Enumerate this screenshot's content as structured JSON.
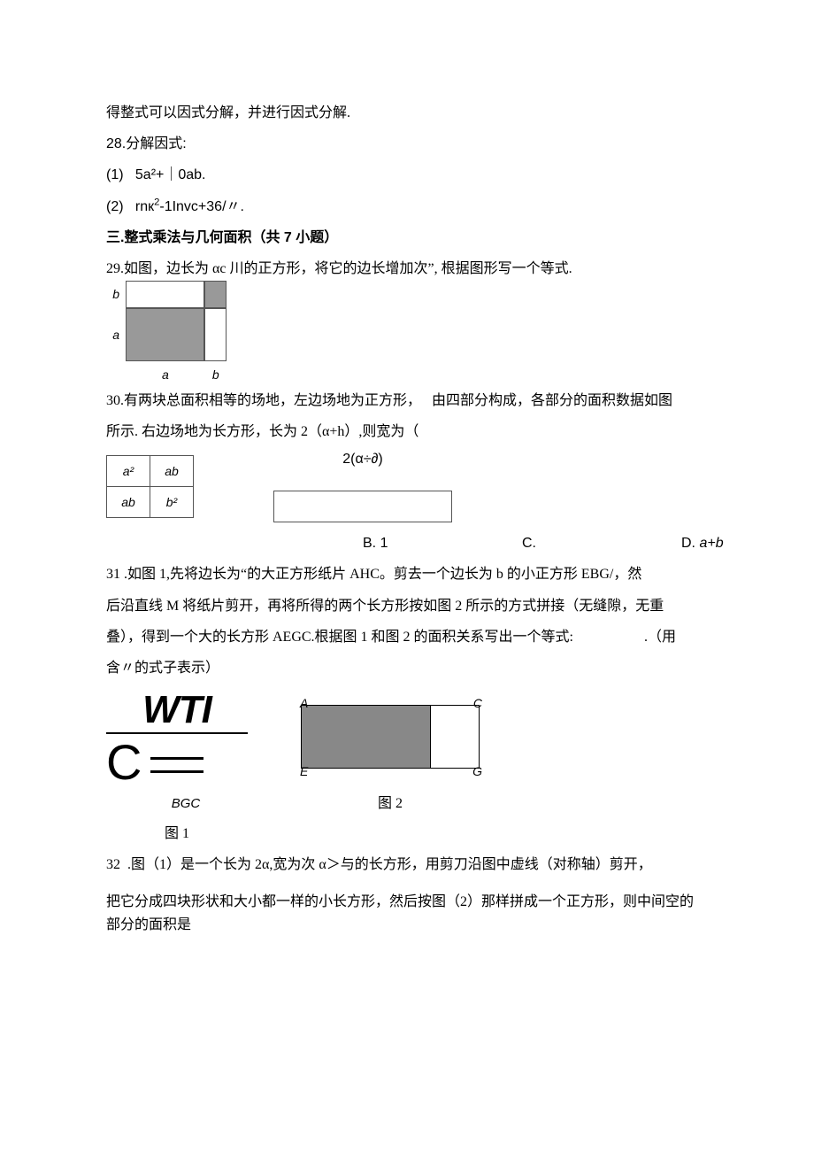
{
  "line_factor": "得整式可以因式分解，并进行因式分解.",
  "q28": {
    "title": "28.分解因式:",
    "p1": "(1)   5a²+｜0ab.",
    "p2_a": "(2)   rnк",
    "p2_b": "-1Invc+36/〃."
  },
  "sec3": "三.整式乘法与几何面积（共 7 小题）",
  "q29": {
    "text": "29.如图，边长为 αc 川的正方形，将它的边长增加次”, 根据图形写一个等式.",
    "lbl_b1": "b",
    "lbl_a1": "a",
    "lbl_a2": "a",
    "lbl_b2": "b"
  },
  "q30": {
    "l1": "30.有两块总面积相等的场地，左边场地为正方形，   由四部分构成，各部分的面积数据如图",
    "l2": "所示. 右边场地为长方形，长为 2（α+h）,则宽为（",
    "a2": "a²",
    "ab": "ab",
    "b2": "b²",
    "top": "2(α÷∂)",
    "cB": "B. 1",
    "cC": "C.",
    "cD_pre": "D. ",
    "cD_val": "a+b"
  },
  "q31": {
    "l1": "31 .如图 1,先将边长为“的大正方形纸片 AHC。剪去一个边长为 b 的小正方形 EBG/，然",
    "l2": "后沿直线 M 将纸片剪开，再将所得的两个长方形按如图 2 所示的方式拼接（无缝隙，无重",
    "l3_a": "叠），得到一个大的长方形 AEGC.根据图 1 和图 2 的面积关系写出一个等式:",
    "l3_b": ".（用",
    "l4": "含〃的式子表示）",
    "wti": "WTI",
    "c": "C",
    "bgc": "BGC",
    "fig1": "图 1",
    "fig2": "图 2",
    "A": "A",
    "Cc": "C",
    "E": "E",
    "G": "G"
  },
  "q32": {
    "l1": "32  .图（1）是一个长为 2α,宽为次 α＞与的长方形，用剪刀沿图中虚线（对称轴）剪开，",
    "l2": "把它分成四块形状和大小都一样的小长方形，然后按图（2）那样拼成一个正方形，则中间空的",
    "l3": "部分的面积是"
  }
}
